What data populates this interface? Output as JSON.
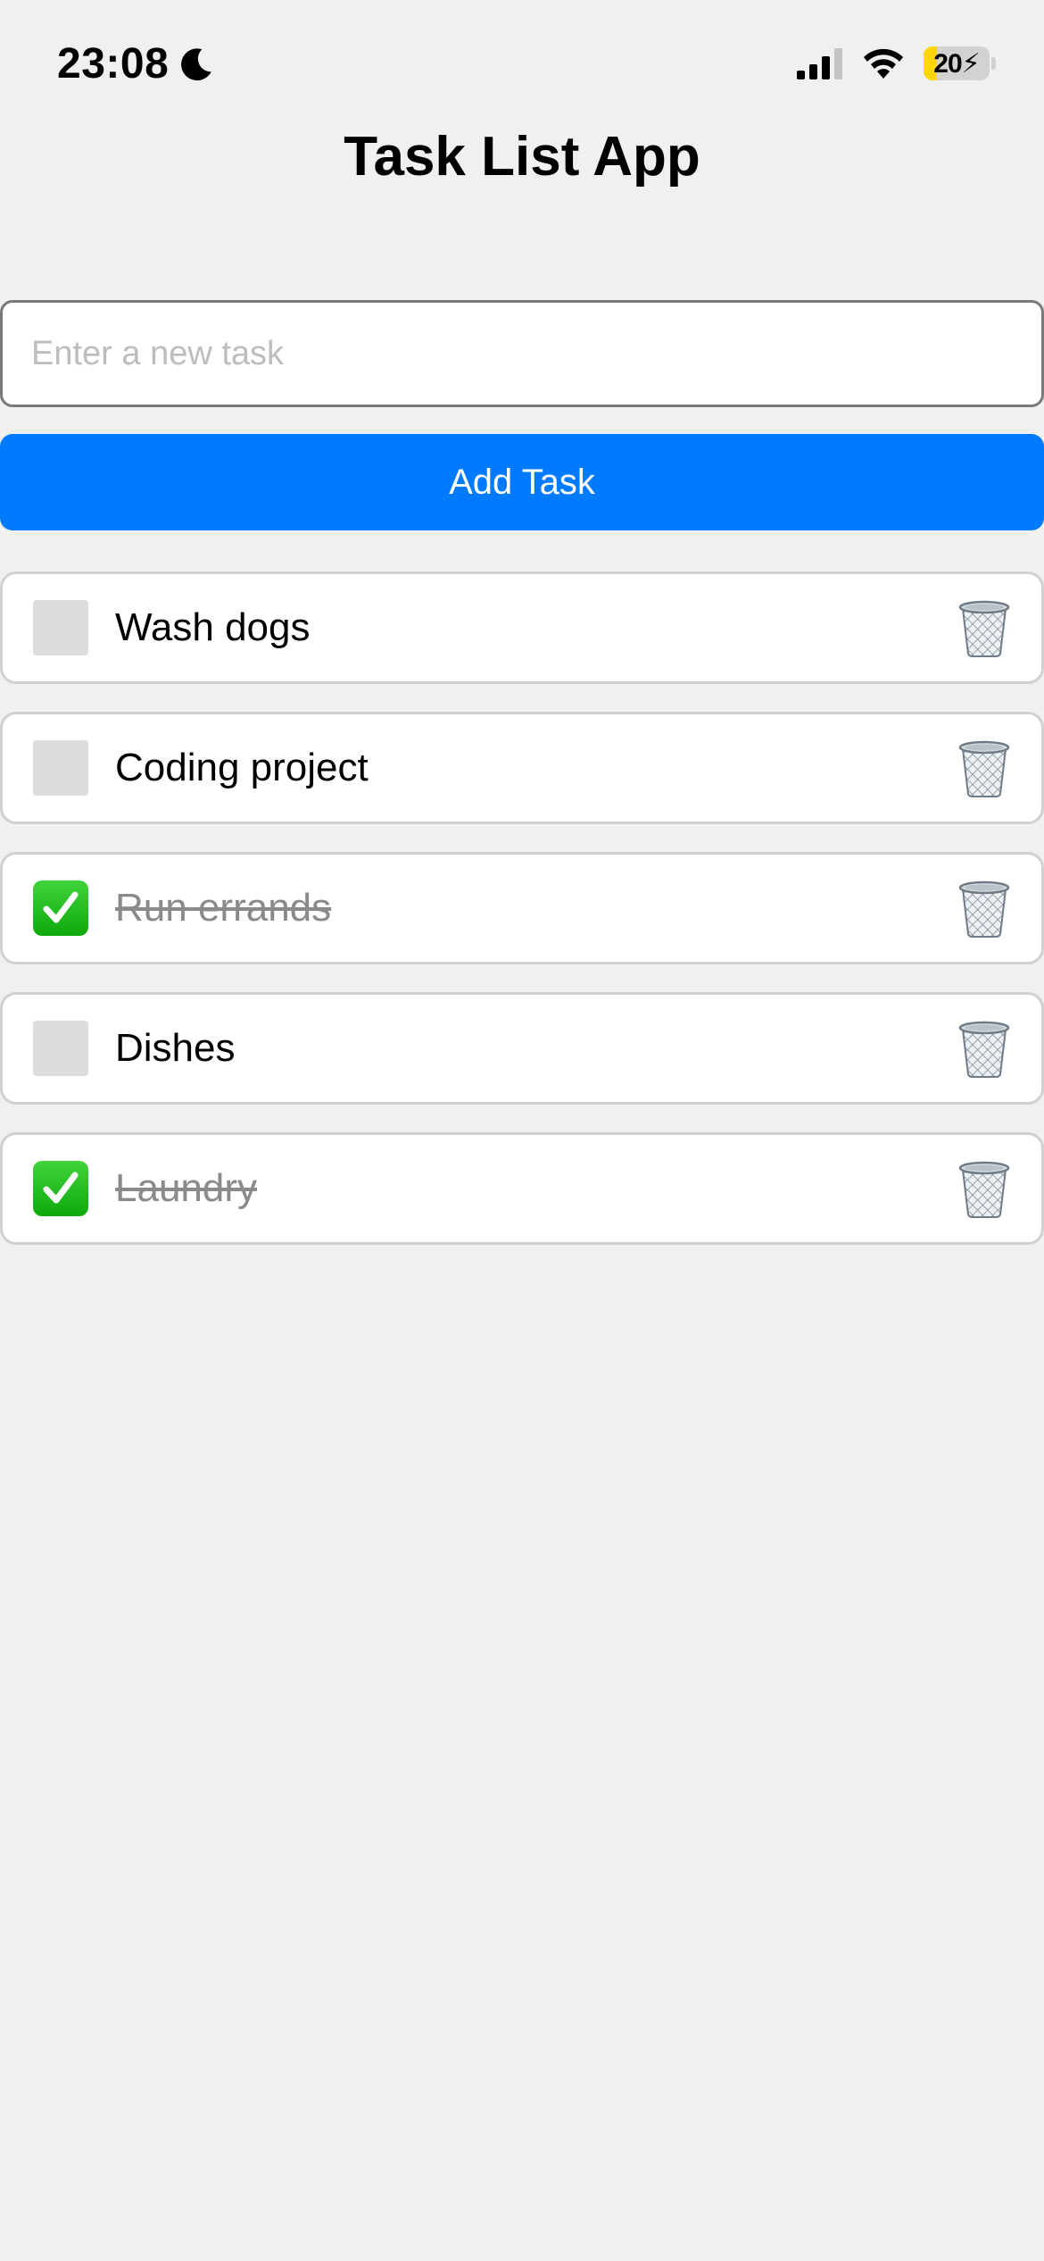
{
  "status_bar": {
    "time": "23:08",
    "battery": "20",
    "battery_level": 0.2
  },
  "app": {
    "title": "Task List App"
  },
  "new_task": {
    "value": "",
    "placeholder": "Enter a new task",
    "add_label": "Add Task"
  },
  "tasks": [
    {
      "label": "Wash dogs",
      "completed": false
    },
    {
      "label": "Coding project",
      "completed": false
    },
    {
      "label": "Run errands",
      "completed": true
    },
    {
      "label": "Dishes",
      "completed": false
    },
    {
      "label": "Laundry",
      "completed": true
    }
  ],
  "colors": {
    "accent": "#007aff",
    "background": "#f0f0f0",
    "checked": "#19b816"
  },
  "icons": {
    "checkbox_checked": "check-mark-button-icon",
    "delete": "wastebasket-icon"
  }
}
